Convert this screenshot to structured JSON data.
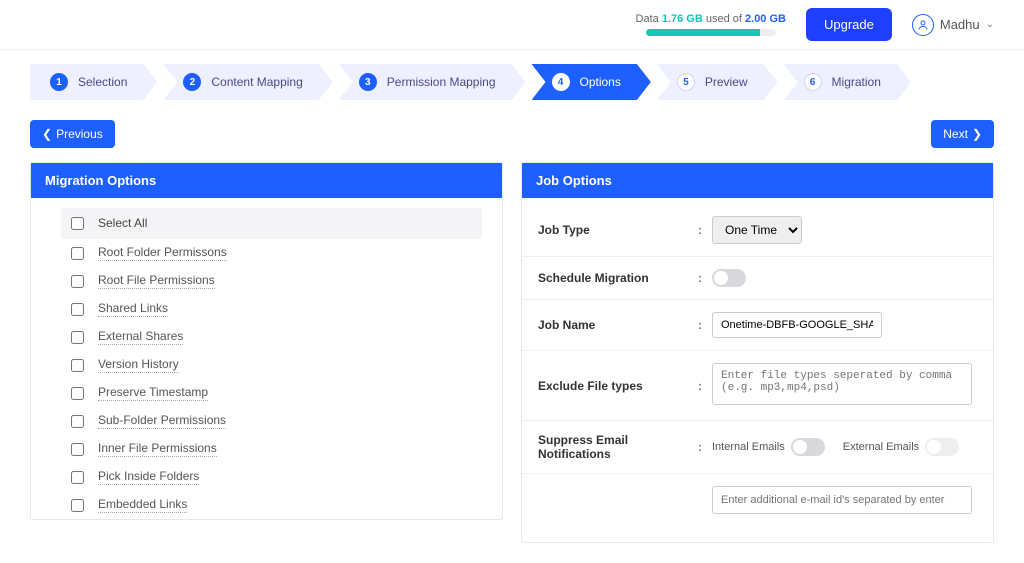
{
  "header": {
    "data_label": "Data",
    "data_used": "1.76 GB",
    "used_of": "used of",
    "data_total": "2.00 GB",
    "upgrade": "Upgrade",
    "username": "Madhu"
  },
  "steps": [
    {
      "num": "1",
      "label": "Selection",
      "state": "done"
    },
    {
      "num": "2",
      "label": "Content Mapping",
      "state": "done"
    },
    {
      "num": "3",
      "label": "Permission Mapping",
      "state": "done"
    },
    {
      "num": "4",
      "label": "Options",
      "state": "active"
    },
    {
      "num": "5",
      "label": "Preview",
      "state": "future"
    },
    {
      "num": "6",
      "label": "Migration",
      "state": "future"
    }
  ],
  "nav": {
    "prev": "Previous",
    "next": "Next"
  },
  "migration_panel": {
    "title": "Migration Options",
    "select_all": "Select All",
    "items": [
      "Root Folder Permissons",
      "Root File Permissions",
      "Shared Links",
      "External Shares",
      "Version History",
      "Preserve Timestamp",
      "Sub-Folder Permissions",
      "Inner File Permissions",
      "Pick Inside Folders",
      "Embedded Links"
    ]
  },
  "job_panel": {
    "title": "Job Options",
    "job_type_label": "Job Type",
    "job_type_value": "One Time",
    "schedule_label": "Schedule Migration",
    "job_name_label": "Job Name",
    "job_name_value": "Onetime-DBFB-GOOGLE_SHARED_",
    "exclude_label": "Exclude File types",
    "exclude_placeholder": "Enter file types seperated by comma (e.g. mp3,mp4,psd)",
    "suppress_label": "Suppress Email Notifications",
    "internal_label": "Internal Emails",
    "external_label": "External Emails",
    "additional_placeholder": "Enter additional e-mail id's separated by enter"
  }
}
